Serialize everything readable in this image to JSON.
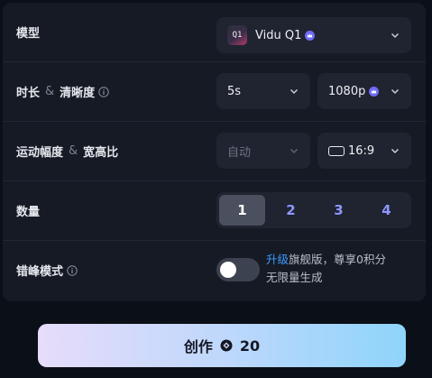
{
  "model_row": {
    "label": "模型",
    "logo_text": "Q1",
    "value": "Vidu Q1",
    "vip_icon": "vip-crown-icon"
  },
  "duration_row": {
    "label_a": "时长",
    "amp": "&",
    "label_b": "清晰度",
    "duration_value": "5s",
    "resolution_value": "1080p"
  },
  "motion_row": {
    "label_a": "运动幅度",
    "amp": "&",
    "label_b": "宽高比",
    "motion_value": "自动",
    "ratio_value": "16:9"
  },
  "count_row": {
    "label": "数量",
    "options": [
      "1",
      "2",
      "3",
      "4"
    ],
    "selected": "1"
  },
  "peak_row": {
    "label": "错峰模式",
    "toggle_on": false,
    "upsell_link": "升级",
    "upsell_text_1": "旗舰版，尊享0积分",
    "upsell_text_2": "无限量生成"
  },
  "create_button": {
    "label": "创作",
    "credits": "20"
  },
  "colors": {
    "panel": "#151a24",
    "control": "#1f2430",
    "accent_link": "#3e9bff",
    "count_accent": "#8f96ff"
  }
}
